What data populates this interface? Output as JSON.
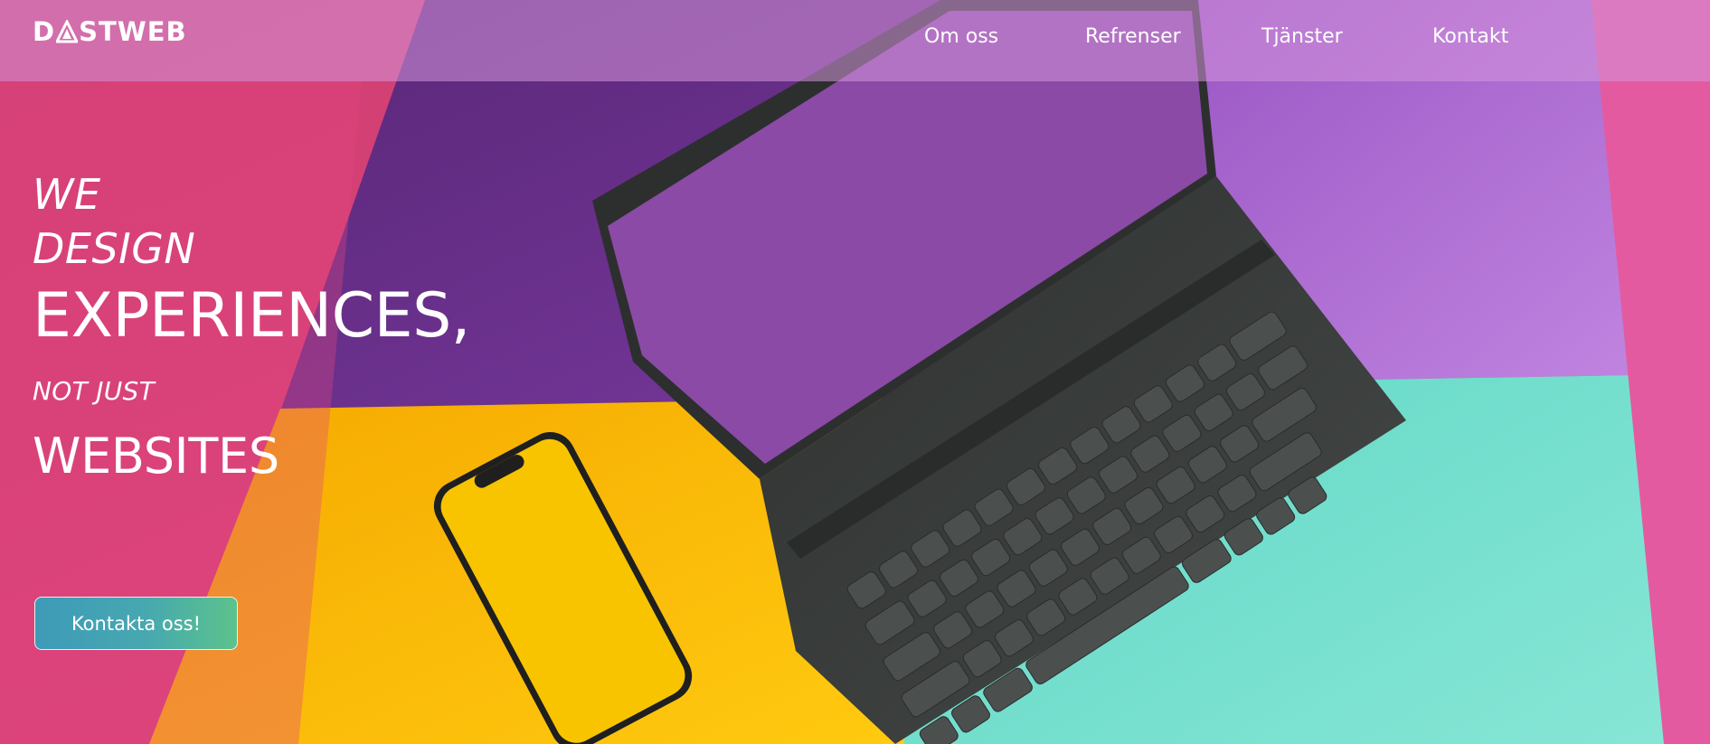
{
  "brand": {
    "logo_text_left": "D",
    "logo_text_right": "STWEB"
  },
  "nav": {
    "items": [
      {
        "label": "Om oss"
      },
      {
        "label": "Refrenser"
      },
      {
        "label": "Tjänster"
      },
      {
        "label": "Kontakt"
      }
    ]
  },
  "hero": {
    "line1": "WE",
    "line2": "DESIGN",
    "line3": "EXPERIENCES,",
    "line4": "NOT JUST",
    "line5": "WEBSITES",
    "cta_label": "Kontakta oss!"
  },
  "colors": {
    "pink": "#e0407a",
    "purple": "#6a2f8c",
    "lavender": "#b46fd6",
    "yellow": "#f7b500",
    "turquoise": "#62d9c7",
    "tablet_screen": "#8a4aa6",
    "phone_screen": "#f8c400",
    "keyboard": "#3a3d3b",
    "cta_start": "#3d9bb8",
    "cta_end": "#5cc38c"
  },
  "icons": [
    "logo-triangle-icon"
  ]
}
